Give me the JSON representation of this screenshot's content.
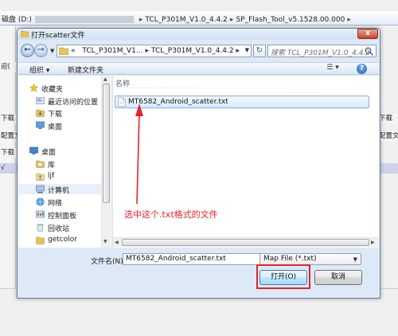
{
  "background_window": {
    "path_prefix": "磁盘 (D:)",
    "path_crumbs": [
      "TCL_P301M_V1.0_4.4.2",
      "SP_Flash_Tool_v5.1528.00.000"
    ],
    "left_fragments": [
      "迎(",
      "下载",
      "配置文",
      "下载",
      "√"
    ],
    "right_fragments": [
      "下载",
      "配置文"
    ]
  },
  "dialog": {
    "title": "打开scatter文件",
    "close_label": "x",
    "nav": {
      "back_glyph": "←",
      "forward_glyph": "→",
      "breadcrumb_overflow": "«",
      "crumbs": [
        "TCL_P301M_V1...",
        "TCL_P301M_V1.0_4.4.2"
      ],
      "refresh_glyph": "↻",
      "search_placeholder": "搜索 TCL_P301M_V1.0_4.4.2"
    },
    "toolbar": {
      "organize": "组织 ▾",
      "new_folder": "新建文件夹",
      "views_glyph": "☰ ▾",
      "help_glyph": "?"
    },
    "sidebar": {
      "items": [
        {
          "label": "收藏夹",
          "icon": "star-icon"
        },
        {
          "label": "最近访问的位置",
          "icon": "recent-places-icon"
        },
        {
          "label": "下载",
          "icon": "download-folder-icon"
        },
        {
          "label": "桌面",
          "icon": "desktop-icon"
        },
        {
          "label": "桌面",
          "icon": "desktop-icon"
        },
        {
          "label": "库",
          "icon": "library-icon"
        },
        {
          "label": "ljf",
          "icon": "user-icon"
        },
        {
          "label": "计算机",
          "icon": "computer-icon"
        },
        {
          "label": "网络",
          "icon": "network-icon"
        },
        {
          "label": "控制面板",
          "icon": "control-panel-icon"
        },
        {
          "label": "回收站",
          "icon": "recycle-bin-icon"
        },
        {
          "label": "getcolor",
          "icon": "folder-icon"
        }
      ]
    },
    "filelist": {
      "column_name": "名称",
      "files": [
        {
          "name": "MT6582_Android_scatter.txt",
          "selected": true
        }
      ]
    },
    "annotation": "选中这个.txt格式的文件",
    "footer": {
      "filename_label": "文件名(N):",
      "filename_value": "MT6582_Android_scatter.txt",
      "filetype_value": "Map File (*.txt)",
      "open_label": "打开(O)",
      "cancel_label": "取消"
    }
  },
  "colors": {
    "annotation_red": "#e8212b",
    "selection_border": "#84acdd",
    "selection_fill": "#d9ebfc",
    "dialog_frame": "#dde9f6"
  }
}
